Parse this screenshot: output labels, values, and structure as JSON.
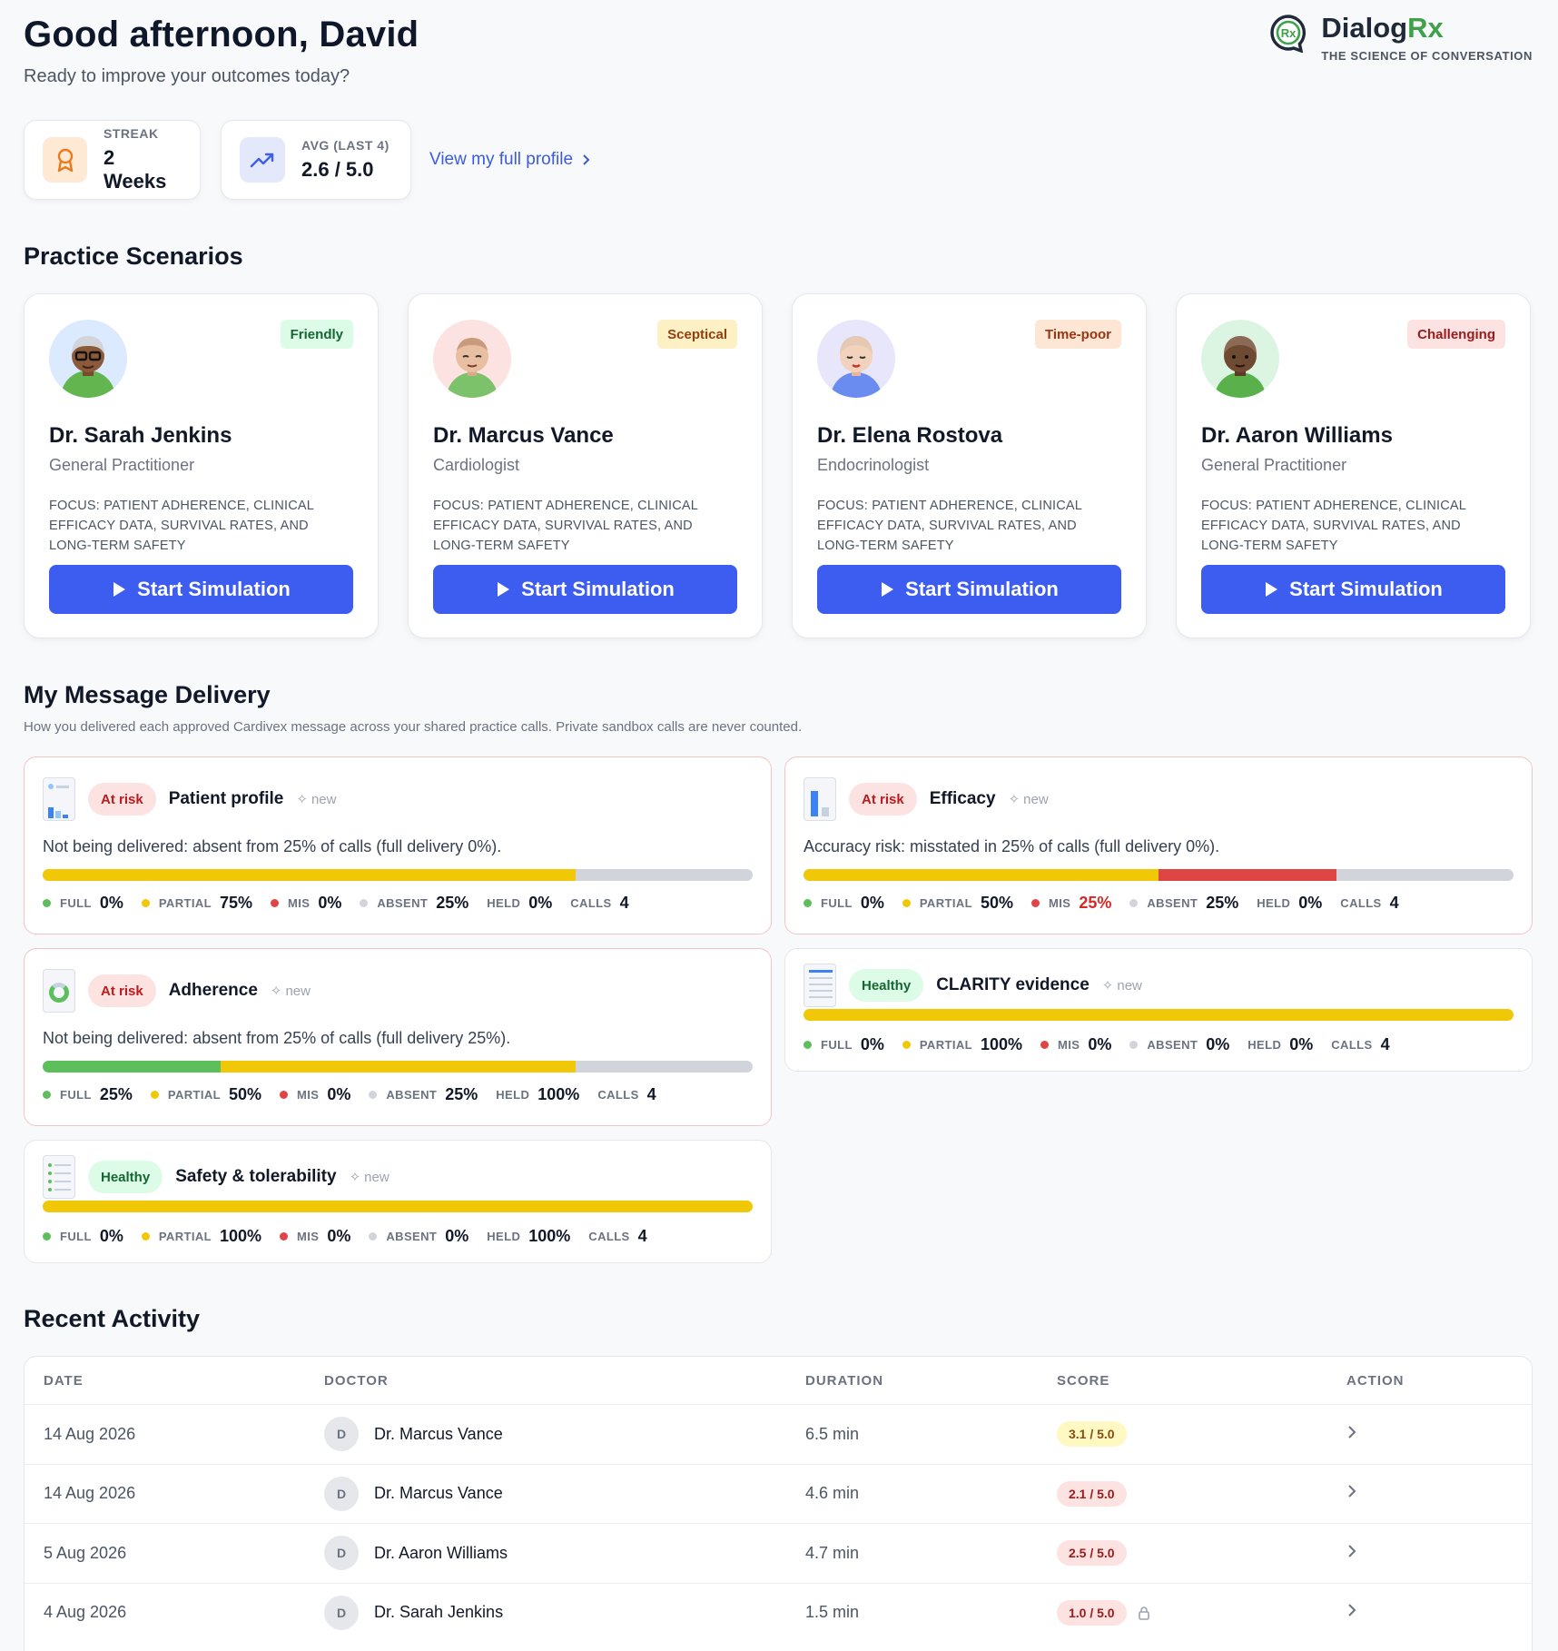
{
  "header": {
    "greeting": "Good afternoon, David",
    "subtitle": "Ready to improve your outcomes today?"
  },
  "brand": {
    "name_part1": "Dialog",
    "name_part2": "Rx",
    "tagline": "THE SCIENCE OF CONVERSATION",
    "icon": "speech-bubble-rx-icon"
  },
  "stats": {
    "streak_label": "STREAK",
    "streak_value": "2 Weeks",
    "avg_label": "AVG (LAST 4)",
    "avg_value": "2.6 / 5.0",
    "profile_link": "View my full profile"
  },
  "scenarios": {
    "title": "Practice Scenarios",
    "cards": [
      {
        "name": "Dr. Sarah Jenkins",
        "role": "General Practitioner",
        "tag": "Friendly",
        "focus": "Focus: Patient adherence, clinical efficacy data, survival rates, and long-term safety",
        "button": "Start Simulation"
      },
      {
        "name": "Dr. Marcus Vance",
        "role": "Cardiologist",
        "tag": "Sceptical",
        "focus": "Focus: Patient adherence, clinical efficacy data, survival rates, and long-term safety",
        "button": "Start Simulation"
      },
      {
        "name": "Dr. Elena Rostova",
        "role": "Endocrinologist",
        "tag": "Time-poor",
        "focus": "Focus: Patient adherence, clinical efficacy data, survival rates, and long-term safety",
        "button": "Start Simulation"
      },
      {
        "name": "Dr. Aaron Williams",
        "role": "General Practitioner",
        "tag": "Challenging",
        "focus": "Focus: Patient adherence, clinical efficacy data, survival rates, and long-term safety",
        "button": "Start Simulation"
      }
    ]
  },
  "delivery": {
    "title": "My Message Delivery",
    "subtitle": "How you delivered each approved Cardivex message across your shared practice calls. Private sandbox calls are never counted.",
    "legend_labels": {
      "full": "FULL",
      "partial": "PARTIAL",
      "mis": "MIS",
      "absent": "ABSENT",
      "held": "HELD",
      "calls": "CALLS"
    },
    "new_label": "new",
    "colors": {
      "full": "#5cbf5c",
      "partial": "#f0c808",
      "mis": "#e04545",
      "absent": "#d1d5db"
    },
    "messages": [
      {
        "status": "At risk",
        "title": "Patient profile",
        "desc": "Not being delivered: absent from 25% of calls (full delivery 0%).",
        "full": "0%",
        "partial": "75%",
        "mis": "0%",
        "absent": "25%",
        "held": "0%",
        "calls": "4",
        "bar": {
          "full": 0,
          "partial": 75,
          "mis": 0
        }
      },
      {
        "status": "At risk",
        "title": "Efficacy",
        "desc": "Accuracy risk: misstated in 25% of calls (full delivery 0%).",
        "full": "0%",
        "partial": "50%",
        "mis": "25%",
        "absent": "25%",
        "held": "0%",
        "calls": "4",
        "bar": {
          "full": 0,
          "partial": 50,
          "mis": 25
        }
      },
      {
        "status": "At risk",
        "title": "Adherence",
        "desc": "Not being delivered: absent from 25% of calls (full delivery 25%).",
        "full": "25%",
        "partial": "50%",
        "mis": "0%",
        "absent": "25%",
        "held": "100%",
        "calls": "4",
        "bar": {
          "full": 25,
          "partial": 50,
          "mis": 0
        }
      },
      {
        "status": "Healthy",
        "title": "CLARITY evidence",
        "desc": "",
        "full": "0%",
        "partial": "100%",
        "mis": "0%",
        "absent": "0%",
        "held": "0%",
        "calls": "4",
        "bar": {
          "full": 0,
          "partial": 100,
          "mis": 0
        }
      },
      {
        "status": "Healthy",
        "title": "Safety & tolerability",
        "desc": "",
        "full": "0%",
        "partial": "100%",
        "mis": "0%",
        "absent": "0%",
        "held": "100%",
        "calls": "4",
        "bar": {
          "full": 0,
          "partial": 100,
          "mis": 0
        }
      }
    ]
  },
  "activity": {
    "title": "Recent Activity",
    "columns": [
      "DATE",
      "DOCTOR",
      "DURATION",
      "SCORE",
      "ACTION"
    ],
    "rows": [
      {
        "date": "14 Aug 2026",
        "initial": "D",
        "doctor": "Dr. Marcus Vance",
        "duration": "6.5 min",
        "score": "3.1 / 5.0"
      },
      {
        "date": "14 Aug 2026",
        "initial": "D",
        "doctor": "Dr. Marcus Vance",
        "duration": "4.6 min",
        "score": "2.1 / 5.0"
      },
      {
        "date": "5 Aug 2026",
        "initial": "D",
        "doctor": "Dr. Aaron Williams",
        "duration": "4.7 min",
        "score": "2.5 / 5.0"
      },
      {
        "date": "4 Aug 2026",
        "initial": "D",
        "doctor": "Dr. Sarah Jenkins",
        "duration": "1.5 min",
        "score": "1.0 / 5.0"
      }
    ]
  }
}
